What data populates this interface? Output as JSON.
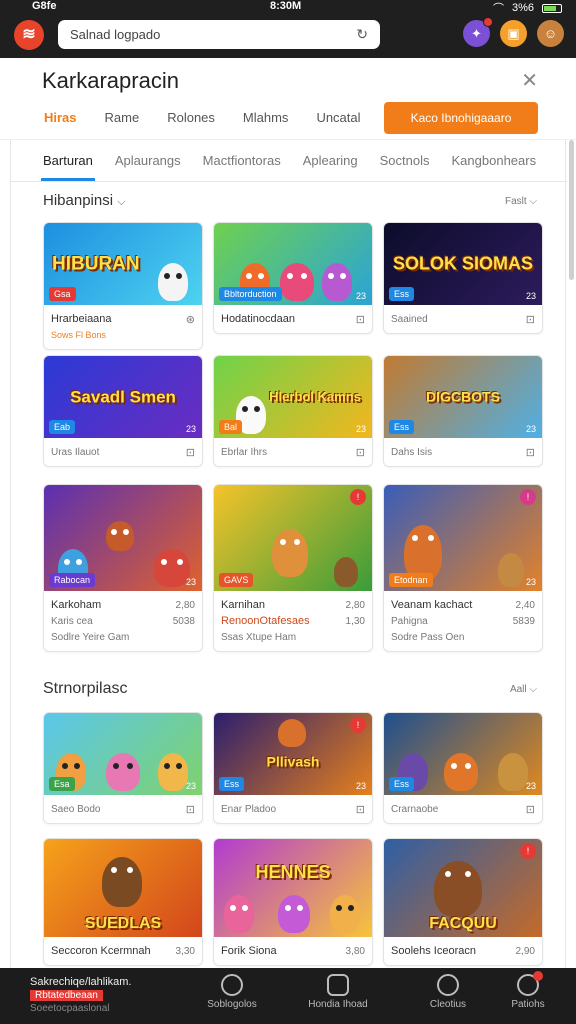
{
  "status": {
    "left": "G8fe",
    "time": "8:30M",
    "right": "3%6"
  },
  "search": {
    "placeholder": "Salnad logpado"
  },
  "page": {
    "title": "Karkarapracin",
    "tabs": [
      "Hiras",
      "Rame",
      "Rolones",
      "Mlahms",
      "Uncatal"
    ],
    "cta": "Kaco Ibnohigaaaro"
  },
  "categories": [
    "Barturan",
    "Aplaurangs",
    "Mactfiontoras",
    "Aplearing",
    "Soctnols",
    "Kangbonhears"
  ],
  "section1": {
    "title": "Hibanpinsi",
    "more": "Faslt"
  },
  "section2": {
    "title": "Strnorpilasc",
    "more": "Aall"
  },
  "cards1": [
    {
      "headline": "HIBURAN",
      "badge": "Gsa",
      "num": "",
      "name": "Hrarbeiaana",
      "tag": "Sows Fl Bons",
      "pin": ""
    },
    {
      "headline": "",
      "badge": "Bbltorduction",
      "num": "23",
      "name": "Hodatinocdaan",
      "tag": "",
      "pin": ""
    },
    {
      "headline": "SOLOK SIOMAS",
      "badge": "Ess",
      "num": "23",
      "name": "Saained",
      "tag": "",
      "pin": ""
    },
    {
      "headline": "Savadl Smen",
      "badge": "Eab",
      "num": "23",
      "name": "Uras Ilauot",
      "tag": "",
      "pin": ""
    },
    {
      "headline": "Hlerbol Kamns",
      "badge": "Bal",
      "num": "23",
      "name": "Ebrlar Ihrs",
      "tag": "",
      "pin": ""
    },
    {
      "headline": "DIGCBOTS",
      "badge": "Ess",
      "num": "23",
      "name": "Dahs Isis",
      "tag": "",
      "pin": ""
    }
  ],
  "cards_tall": [
    {
      "badge": "Rabocan",
      "num": "23",
      "name": "Karkoham",
      "price": "2,80",
      "sub": "Karis cea",
      "sub2": "5038",
      "line3": "Sodlre Yeire Gam",
      "pin": ""
    },
    {
      "badge": "GAVS",
      "num": "",
      "name": "Karnihan",
      "price": "2,80",
      "sub": "RenoonOtafesaes",
      "sub2": "1,30",
      "line3": "Ssas Xtupe Ham",
      "pin": "!"
    },
    {
      "badge": "Etodnan",
      "num": "23",
      "name": "Veanam kachact",
      "price": "2,40",
      "sub": "Pahigna",
      "sub2": "5839",
      "line3": "Sodre Pass Oen",
      "pin": "!"
    }
  ],
  "cards2": [
    {
      "headline": "",
      "badge": "Esa",
      "num": "23",
      "name": "Saeo Bodo",
      "pin": ""
    },
    {
      "headline": "Pllivash",
      "badge": "Ess",
      "num": "23",
      "name": "Enar Pladoo",
      "pin": "!"
    },
    {
      "headline": "",
      "badge": "Ess",
      "num": "23",
      "name": "Crarnaobe",
      "pin": ""
    }
  ],
  "cards3": [
    {
      "headline": "SUEDLAS",
      "name": "Seccoron Kcermnah",
      "price": "3,30",
      "sub": "",
      "pin": ""
    },
    {
      "headline": "HENNES",
      "name": "Forik Siona",
      "price": "3,80",
      "sub": "",
      "pin": ""
    },
    {
      "headline": "FACQUU",
      "name": "Soolehs Iceoracn",
      "price": "2,90",
      "sub": "",
      "pin": "!"
    }
  ],
  "bottom": {
    "promo_1": "Sakrechiqe/lahlikam.",
    "promo_2": "Rbtatedbeaan",
    "promo_3": "Soeetocpaaslonal",
    "items": [
      "Soblogolos",
      "Hondia Ihoad",
      "Cleotius",
      "Patiohs"
    ]
  }
}
